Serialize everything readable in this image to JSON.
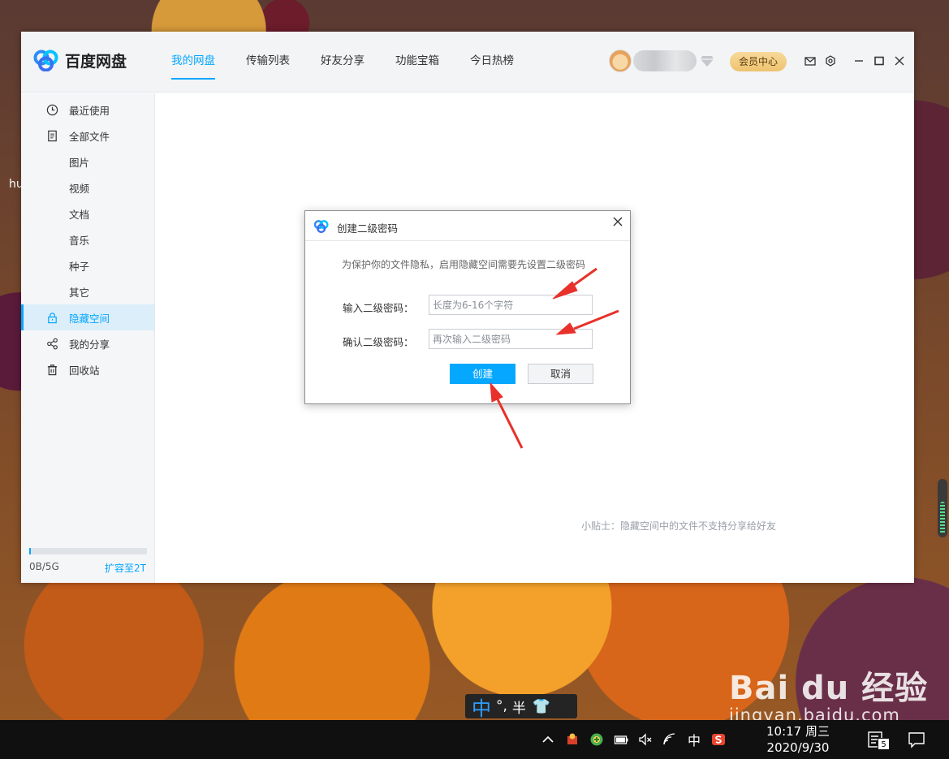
{
  "desktop": {
    "stray_text": "hu"
  },
  "app": {
    "name": "百度网盘",
    "nav": [
      {
        "label": "我的网盘",
        "active": true
      },
      {
        "label": "传输列表",
        "active": false
      },
      {
        "label": "好友分享",
        "active": false
      },
      {
        "label": "功能宝箱",
        "active": false
      },
      {
        "label": "今日热榜",
        "active": false
      }
    ],
    "vip_button": "会员中心",
    "icons": {
      "mail": "mail-icon",
      "settings": "settings-icon",
      "minimize": "minimize-icon",
      "maximize": "maximize-icon",
      "close": "close-icon",
      "diamond": "diamond-icon"
    }
  },
  "sidebar": {
    "items": [
      {
        "label": "最近使用",
        "icon": "clock-icon",
        "sub": false
      },
      {
        "label": "全部文件",
        "icon": "file-icon",
        "sub": false
      },
      {
        "label": "图片",
        "sub": true
      },
      {
        "label": "视频",
        "sub": true
      },
      {
        "label": "文档",
        "sub": true
      },
      {
        "label": "音乐",
        "sub": true
      },
      {
        "label": "种子",
        "sub": true
      },
      {
        "label": "其它",
        "sub": true
      },
      {
        "label": "隐藏空间",
        "icon": "lock-icon",
        "sub": false,
        "active": true
      },
      {
        "label": "我的分享",
        "icon": "share-icon",
        "sub": false
      },
      {
        "label": "回收站",
        "icon": "trash-icon",
        "sub": false
      }
    ],
    "quota": {
      "used_text": "0B/5G",
      "upgrade_link": "扩容至2T",
      "fill_fraction": 0.01
    }
  },
  "content": {
    "tip": "小贴士：隐藏空间中的文件不支持分享给好友"
  },
  "dialog": {
    "title": "创建二级密码",
    "description": "为保护你的文件隐私，启用隐藏空间需要先设置二级密码",
    "password_label": "输入二级密码：",
    "password_placeholder": "长度为6-16个字符",
    "confirm_label": "确认二级密码：",
    "confirm_placeholder": "再次输入二级密码",
    "create_button": "创建",
    "cancel_button": "取消"
  },
  "ime": {
    "mode": "中",
    "punct": "°,",
    "width": "半",
    "skin": "👕"
  },
  "watermark": {
    "brand": "Bai du 经验",
    "url": "jingyan.baidu.com"
  },
  "taskbar": {
    "time": "10:17 周三",
    "date": "2020/9/30",
    "ime_indicator": "中",
    "notification_count": "5"
  },
  "colors": {
    "accent": "#06a7ff",
    "annotation": "#e8312a",
    "vip": "#eec370"
  }
}
